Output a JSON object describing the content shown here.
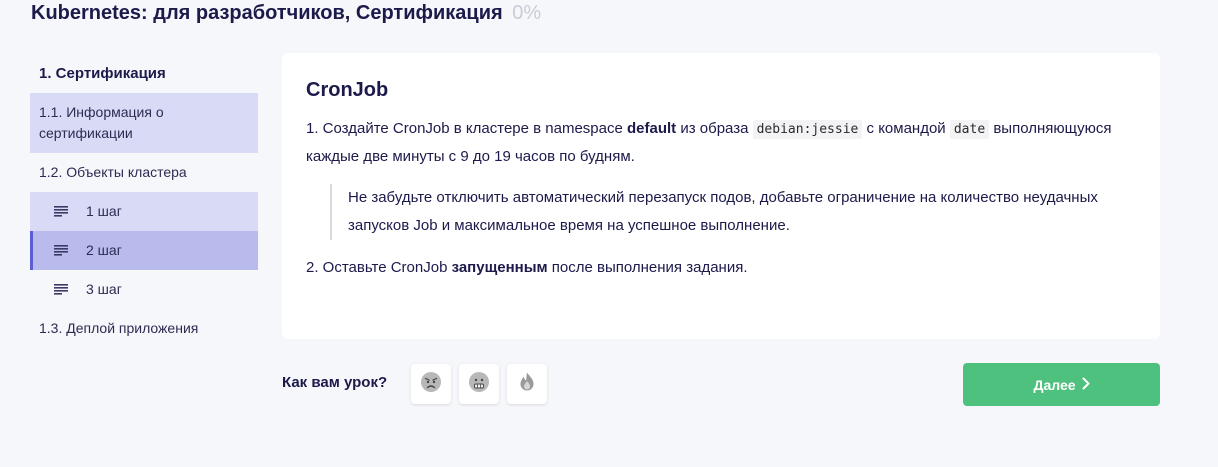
{
  "course": {
    "title": "Kubernetes: для разработчиков, Сертификация",
    "progress": "0%"
  },
  "sidebar": {
    "section": "1. Сертификация",
    "items": [
      {
        "label": "1.1. Информация о сертификации"
      },
      {
        "label": "1.2. Объекты кластера"
      },
      {
        "label": "1 шаг"
      },
      {
        "label": "2 шаг"
      },
      {
        "label": "3 шаг"
      },
      {
        "label": "1.3. Деплой приложения"
      }
    ]
  },
  "content": {
    "title": "CronJob",
    "task1": {
      "prefix": "1. Создайте CronJob в кластере в namespace ",
      "ns": "default",
      "mid": " из образа ",
      "image": "debian:jessie",
      "mid2": " с командой ",
      "command": "date",
      "suffix": " выполняющуюся каждые две минуты с 9 до 19 часов по будням."
    },
    "note": "Не забудьте отключить автоматический перезапуск подов, добавьте ограничение на количество неудачных запусков Job и максимальное время на успешное выполнение.",
    "task2": {
      "prefix": "2. Оставьте CronJob ",
      "bold": "запущенным",
      "suffix": " после выполнения задания."
    }
  },
  "footer": {
    "rate_label": "Как вам урок?",
    "rating_icons": [
      "angry-face-icon",
      "grimacing-face-icon",
      "fire-icon"
    ],
    "next_label": "Далее"
  }
}
